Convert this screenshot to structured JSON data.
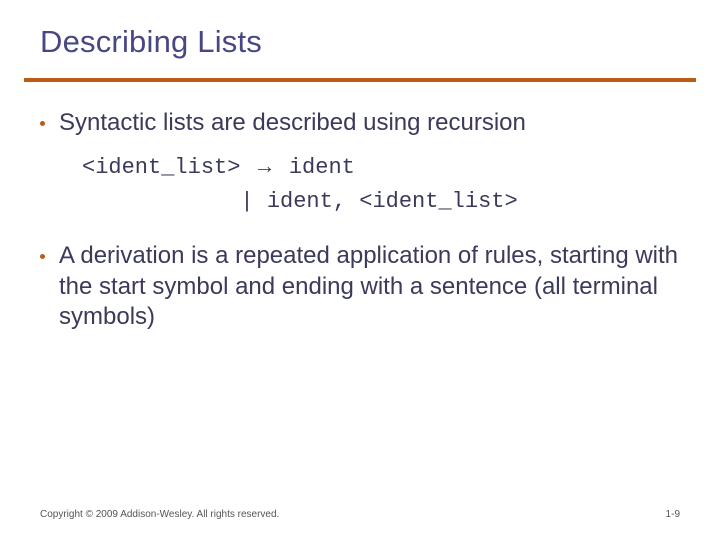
{
  "title": "Describing Lists",
  "bullets": [
    "Syntactic lists are described using recursion",
    "A derivation is a repeated application of rules, starting with the start symbol and ending with a sentence (all terminal symbols)"
  ],
  "code": {
    "line1_lhs": "<ident_list>",
    "arrow": "→",
    "line1_rhs": "ident",
    "line2": "            | ident, <ident_list>"
  },
  "footer": {
    "copyright": "Copyright © 2009 Addison-Wesley. All rights reserved.",
    "page": "1-9"
  }
}
